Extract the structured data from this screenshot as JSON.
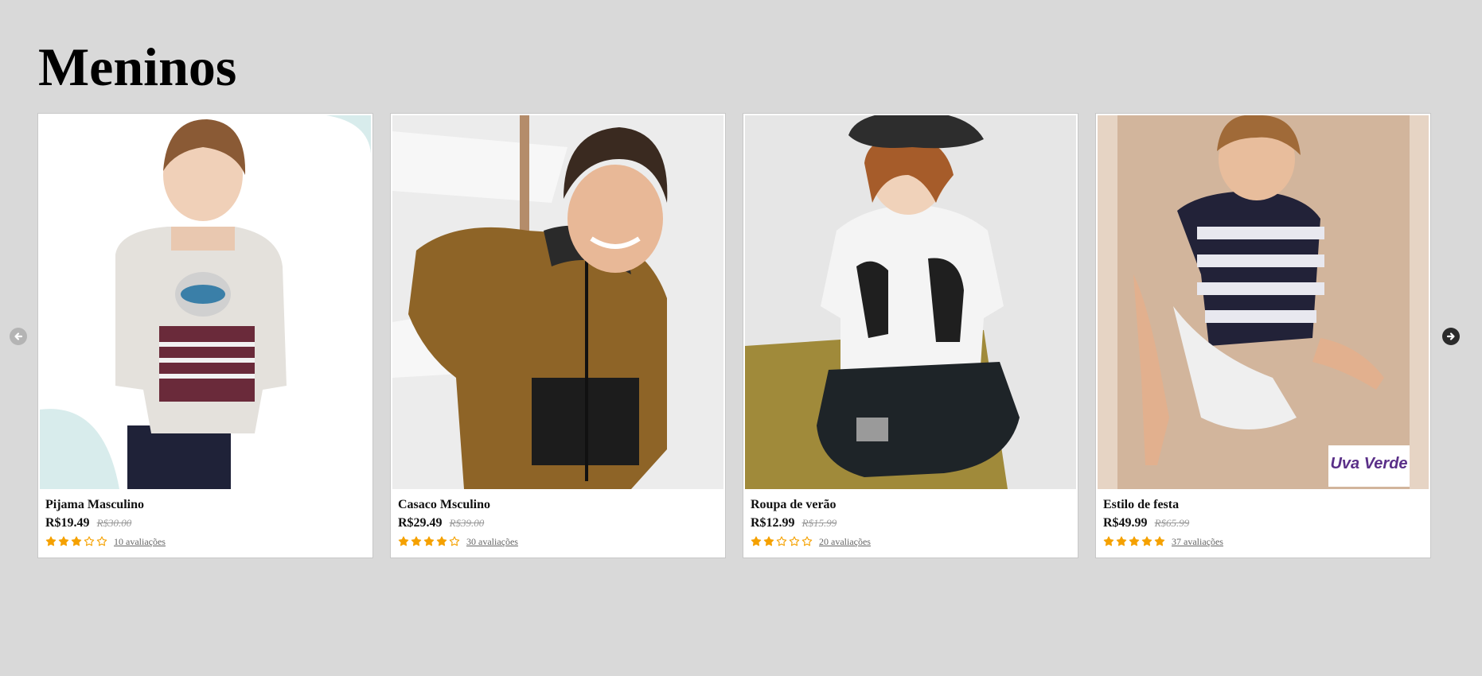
{
  "page": {
    "title": "Meninos"
  },
  "carousel": {
    "prev_icon": "arrow-left-circle-icon",
    "next_icon": "arrow-right-circle-icon",
    "products": [
      {
        "name": "Pijama Masculino",
        "price": "R$19.49",
        "old_price": "R$30.00",
        "rating": 3,
        "reviews": "10 avaliações",
        "image": "boy-grey-koala-sweatshirt-photo"
      },
      {
        "name": "Casaco Msculino",
        "price": "R$29.49",
        "old_price": "R$39.00",
        "rating": 4,
        "reviews": "30 avaliações",
        "image": "boy-brown-hoodie-photo"
      },
      {
        "name": "Roupa de verão",
        "price": "R$12.99",
        "old_price": "R$15.99",
        "rating": 2,
        "reviews": "20 avaliações",
        "image": "boy-bucket-hat-white-tee-photo"
      },
      {
        "name": "Estilo de festa",
        "price": "R$49.99",
        "old_price": "R$65.99",
        "rating": 5,
        "reviews": "37 avaliações",
        "image": "boy-striped-shirt-sand-photo",
        "logo_text": "Uva Verde"
      }
    ],
    "max_rating": 5
  },
  "colors": {
    "page_background": "#d9d9d9",
    "star_fill": "#f5a100",
    "card_background": "#ffffff"
  }
}
